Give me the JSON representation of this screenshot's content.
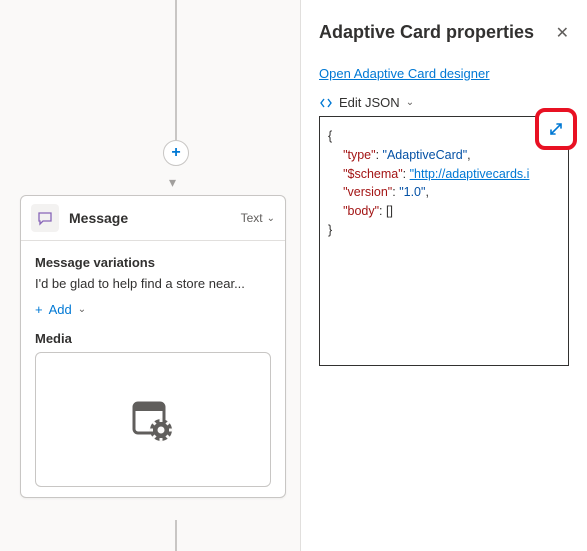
{
  "canvas": {
    "plus_label": "+",
    "card": {
      "title": "Message",
      "type_label": "Text",
      "variations_label": "Message variations",
      "variation_preview": "I'd be glad to help find a store near...",
      "add_label": "Add",
      "media_label": "Media"
    }
  },
  "panel": {
    "title": "Adaptive Card properties",
    "designer_link": "Open Adaptive Card designer",
    "edit_json_label": "Edit JSON",
    "json": {
      "line1_key": "\"type\"",
      "line1_val": "\"AdaptiveCard\"",
      "line2_key": "\"$schema\"",
      "line2_val": "\"http://adaptivecards.i",
      "line3_key": "\"version\"",
      "line3_val": "\"1.0\"",
      "line4_key": "\"body\"",
      "line4_val": "[]"
    }
  }
}
